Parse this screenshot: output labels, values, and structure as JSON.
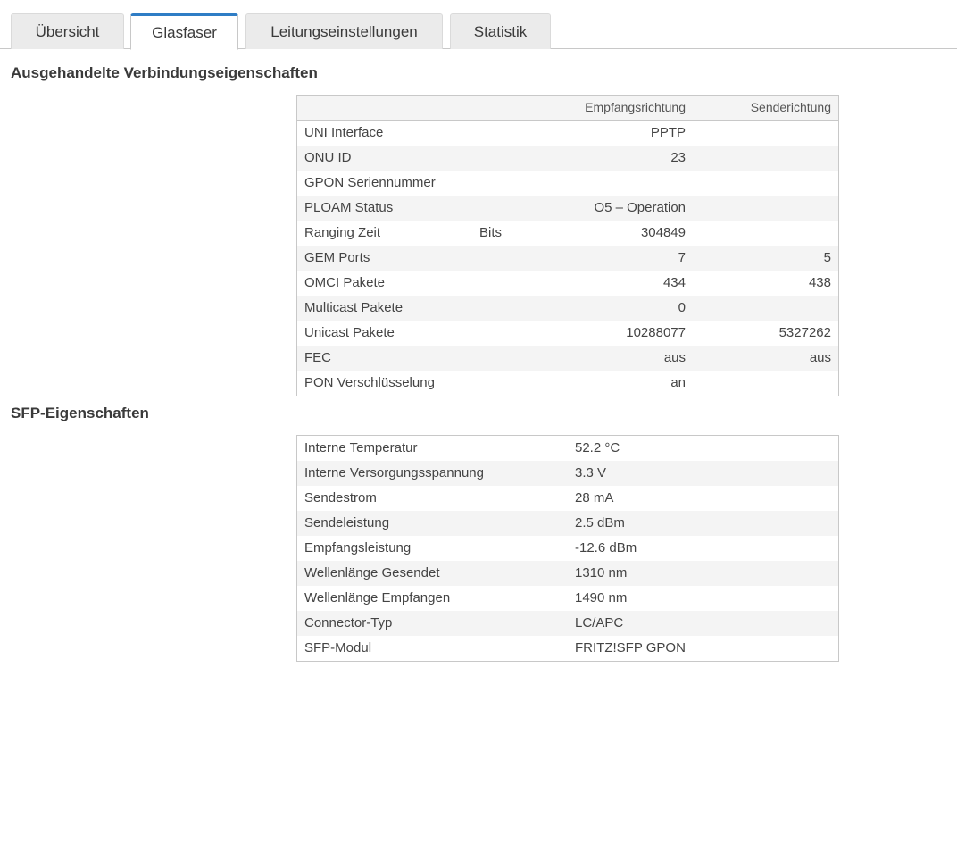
{
  "tabs": [
    "Übersicht",
    "Glasfaser",
    "Leitungseinstellungen",
    "Statistik"
  ],
  "active_tab": "Glasfaser",
  "connection": {
    "title": "Ausgehandelte Verbindungseigenschaften",
    "header": {
      "rx": "Empfangsrichtung",
      "tx": "Senderichtung"
    },
    "rows": [
      {
        "label": "UNI Interface",
        "unit": "",
        "rx": "PPTP",
        "tx": ""
      },
      {
        "label": "ONU ID",
        "unit": "",
        "rx": "23",
        "tx": ""
      },
      {
        "label": "GPON Seriennummer",
        "unit": "",
        "rx": "",
        "tx": ""
      },
      {
        "label": "PLOAM Status",
        "unit": "",
        "rx": "O5 – Operation",
        "tx": ""
      },
      {
        "label": "Ranging Zeit",
        "unit": "Bits",
        "rx": "304849",
        "tx": ""
      },
      {
        "label": "GEM Ports",
        "unit": "",
        "rx": "7",
        "tx": "5"
      },
      {
        "label": "OMCI Pakete",
        "unit": "",
        "rx": "434",
        "tx": "438"
      },
      {
        "label": "Multicast Pakete",
        "unit": "",
        "rx": "0",
        "tx": ""
      },
      {
        "label": "Unicast Pakete",
        "unit": "",
        "rx": "10288077",
        "tx": "5327262"
      },
      {
        "label": "FEC",
        "unit": "",
        "rx": "aus",
        "tx": "aus"
      },
      {
        "label": "PON Verschlüsselung",
        "unit": "",
        "rx": "an",
        "tx": ""
      }
    ]
  },
  "sfp": {
    "title": "SFP-Eigenschaften",
    "rows": [
      {
        "label": "Interne Temperatur",
        "value": "52.2 °C"
      },
      {
        "label": "Interne Versorgungsspannung",
        "value": "3.3 V"
      },
      {
        "label": "Sendestrom",
        "value": "28 mA"
      },
      {
        "label": "Sendeleistung",
        "value": "2.5 dBm"
      },
      {
        "label": "Empfangsleistung",
        "value": "-12.6 dBm"
      },
      {
        "label": "Wellenlänge Gesendet",
        "value": "1310 nm"
      },
      {
        "label": "Wellenlänge Empfangen",
        "value": "1490 nm"
      },
      {
        "label": "Connector-Typ",
        "value": "LC/APC"
      },
      {
        "label": "SFP-Modul",
        "value": "FRITZ!SFP GPON"
      }
    ]
  }
}
